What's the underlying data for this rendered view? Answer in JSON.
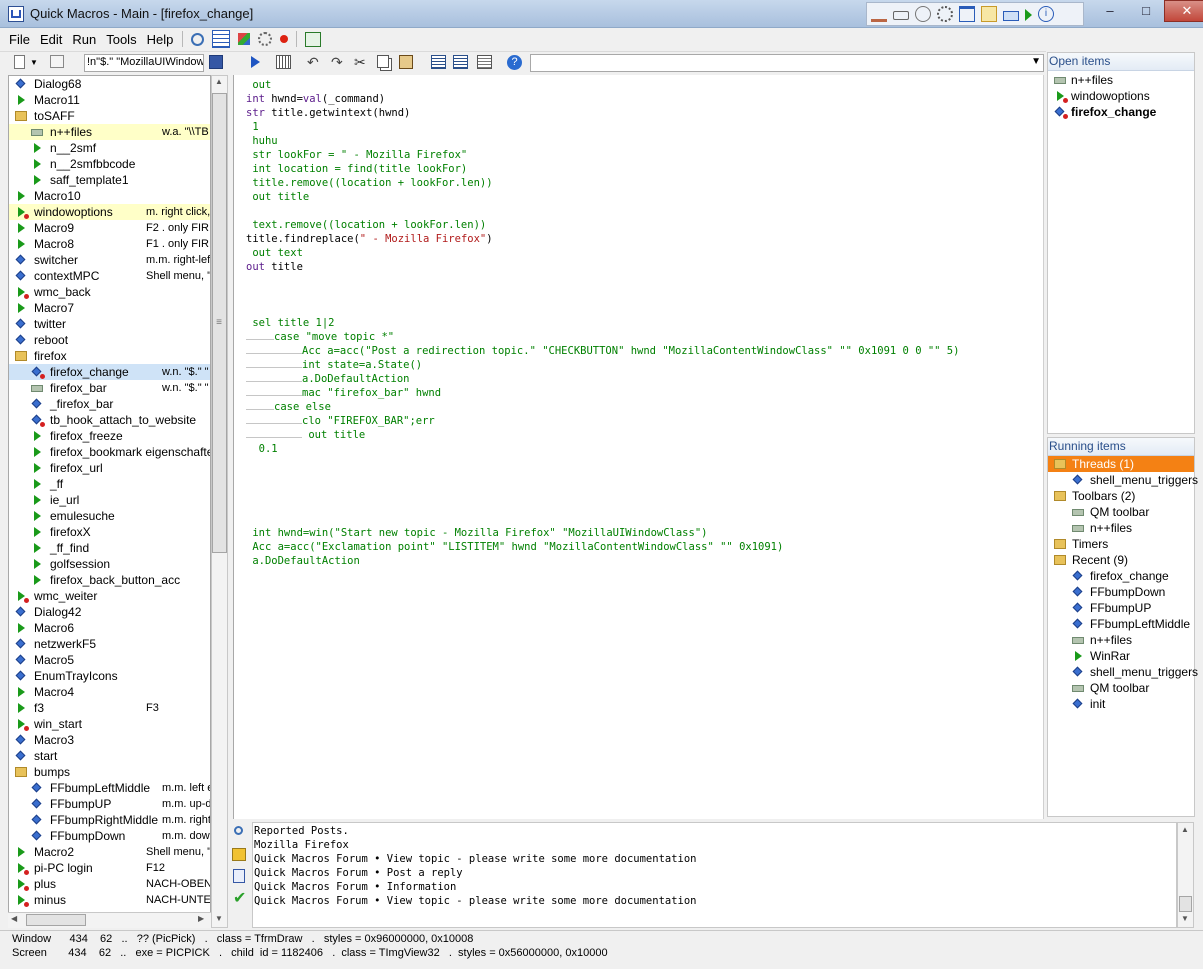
{
  "window": {
    "title": "Quick Macros - Main - [firefox_change]",
    "controls": {
      "minimize": "–",
      "maximize": "□",
      "close": "✕"
    }
  },
  "menu": {
    "items": [
      "File",
      "Edit",
      "Run",
      "Tools",
      "Help"
    ]
  },
  "toolbar": {
    "command_text": "!n\"$.\" \"MozillaUIWindowCla",
    "find_value": ""
  },
  "tree": {
    "items": [
      {
        "label": "Dialog68",
        "icon": "macro",
        "indent": 0
      },
      {
        "label": "Macro11",
        "icon": "function",
        "indent": 0
      },
      {
        "label": "toSAFF",
        "icon": "folder",
        "indent": 0
      },
      {
        "label": "n++files",
        "icon": "toolbar",
        "indent": 1,
        "trigger": "w.a. \"\\\\TB",
        "highlight": true
      },
      {
        "label": "n__2smf",
        "icon": "function",
        "indent": 1
      },
      {
        "label": "n__2smfbbcode",
        "icon": "function",
        "indent": 1
      },
      {
        "label": "saff_template1",
        "icon": "function",
        "indent": 1
      },
      {
        "label": "Macro10",
        "icon": "function",
        "indent": 0
      },
      {
        "label": "windowoptions",
        "icon": "function-red",
        "indent": 0,
        "trigger": "m. right click,",
        "highlight": true
      },
      {
        "label": "Macro9",
        "icon": "function",
        "indent": 0,
        "trigger": "F2  .  only FIR"
      },
      {
        "label": "Macro8",
        "icon": "function",
        "indent": 0,
        "trigger": "F1  .  only FIR"
      },
      {
        "label": "switcher",
        "icon": "macro",
        "indent": 0,
        "trigger": "m.m. right-left,"
      },
      {
        "label": "contextMPC",
        "icon": "macro",
        "indent": 0,
        "trigger": "Shell menu, \""
      },
      {
        "label": "wmc_back",
        "icon": "function-red",
        "indent": 0
      },
      {
        "label": "Macro7",
        "icon": "function",
        "indent": 0
      },
      {
        "label": "twitter",
        "icon": "macro",
        "indent": 0
      },
      {
        "label": "reboot",
        "icon": "macro",
        "indent": 0
      },
      {
        "label": "firefox",
        "icon": "folder",
        "indent": 0
      },
      {
        "label": "firefox_change",
        "icon": "macro-red",
        "indent": 1,
        "trigger": "w.n. \"$.\" \"",
        "selected": true
      },
      {
        "label": "firefox_bar",
        "icon": "toolbar",
        "indent": 1,
        "trigger": "w.n. \"$.\" \""
      },
      {
        "label": "_firefox_bar",
        "icon": "macro",
        "indent": 1
      },
      {
        "label": "tb_hook_attach_to_website",
        "icon": "macro-red",
        "indent": 1
      },
      {
        "label": "firefox_freeze",
        "icon": "function",
        "indent": 1
      },
      {
        "label": "firefox_bookmark eigenschaften",
        "icon": "function",
        "indent": 1
      },
      {
        "label": "firefox_url",
        "icon": "function",
        "indent": 1
      },
      {
        "label": "_ff",
        "icon": "function",
        "indent": 1
      },
      {
        "label": "ie_url",
        "icon": "function",
        "indent": 1
      },
      {
        "label": "emulesuche",
        "icon": "function",
        "indent": 1
      },
      {
        "label": "firefoxX",
        "icon": "function",
        "indent": 1
      },
      {
        "label": "_ff_find",
        "icon": "function",
        "indent": 1
      },
      {
        "label": "golfsession",
        "icon": "function",
        "indent": 1
      },
      {
        "label": "firefox_back_button_acc",
        "icon": "function",
        "indent": 1
      },
      {
        "label": "wmc_weiter",
        "icon": "function-red",
        "indent": 0
      },
      {
        "label": "Dialog42",
        "icon": "macro",
        "indent": 0
      },
      {
        "label": "Macro6",
        "icon": "function",
        "indent": 0
      },
      {
        "label": "netzwerkF5",
        "icon": "macro",
        "indent": 0
      },
      {
        "label": "Macro5",
        "icon": "macro",
        "indent": 0
      },
      {
        "label": "EnumTrayIcons",
        "icon": "macro",
        "indent": 0
      },
      {
        "label": "Macro4",
        "icon": "function",
        "indent": 0
      },
      {
        "label": "f3",
        "icon": "function",
        "indent": 0,
        "trigger": "F3"
      },
      {
        "label": "win_start",
        "icon": "function-red",
        "indent": 0
      },
      {
        "label": "Macro3",
        "icon": "macro",
        "indent": 0
      },
      {
        "label": "start",
        "icon": "macro",
        "indent": 0
      },
      {
        "label": "bumps",
        "icon": "folder",
        "indent": 0
      },
      {
        "label": "FFbumpLeftMiddle",
        "icon": "macro",
        "indent": 1,
        "trigger": "m.m. left e"
      },
      {
        "label": "FFbumpUP",
        "icon": "macro",
        "indent": 1,
        "trigger": "m.m. up-do"
      },
      {
        "label": "FFbumpRightMiddle",
        "icon": "macro",
        "indent": 1,
        "trigger": "m.m. right"
      },
      {
        "label": "FFbumpDown",
        "icon": "macro",
        "indent": 1,
        "trigger": "m.m. dowr"
      },
      {
        "label": "Macro2",
        "icon": "function",
        "indent": 0,
        "trigger": "Shell menu, \""
      },
      {
        "label": "pi-PC login",
        "icon": "function-red",
        "indent": 0,
        "trigger": "F12"
      },
      {
        "label": "plus",
        "icon": "function-red",
        "indent": 0,
        "trigger": "NACH-OBEN"
      },
      {
        "label": "minus",
        "icon": "function-red",
        "indent": 0,
        "trigger": "NACH-UNTE"
      }
    ]
  },
  "editor": {
    "lines": [
      {
        "row": 0,
        "type": "cmt",
        "text": " out"
      },
      {
        "row": 1,
        "type": "code",
        "parts": [
          [
            "kw",
            "int"
          ],
          [
            "plain",
            " hwnd="
          ],
          [
            "kw",
            "val"
          ],
          [
            "plain",
            "(_command)"
          ]
        ]
      },
      {
        "row": 2,
        "type": "code",
        "parts": [
          [
            "kw",
            "str"
          ],
          [
            "plain",
            " title.getwintext(hwnd)"
          ]
        ]
      },
      {
        "row": 3,
        "type": "cmt",
        "text": " 1"
      },
      {
        "row": 4,
        "type": "cmt",
        "text": " huhu"
      },
      {
        "row": 5,
        "type": "cmt",
        "text": " str lookFor = \" - Mozilla Firefox\""
      },
      {
        "row": 6,
        "type": "cmt",
        "text": " int location = find(title lookFor)"
      },
      {
        "row": 7,
        "type": "cmt",
        "text": " title.remove((location + lookFor.len))"
      },
      {
        "row": 8,
        "type": "cmt",
        "text": " out title"
      },
      {
        "row": 10,
        "type": "cmt",
        "text": " text.remove((location + lookFor.len))"
      },
      {
        "row": 11,
        "type": "code",
        "parts": [
          [
            "plain",
            "title.findreplace("
          ],
          [
            "str",
            "\" - Mozilla Firefox\""
          ],
          [
            "plain",
            ")"
          ]
        ]
      },
      {
        "row": 12,
        "type": "cmt",
        "text": " out text"
      },
      {
        "row": 13,
        "type": "code",
        "parts": [
          [
            "kw",
            "out"
          ],
          [
            "plain",
            " title"
          ]
        ]
      },
      {
        "row": 17,
        "type": "cmt",
        "text": " sel title 1|2"
      },
      {
        "row": 18,
        "type": "cmt",
        "indent": 1,
        "text": "case \"move topic *\""
      },
      {
        "row": 19,
        "type": "cmt",
        "indent": 2,
        "text": "Acc a=acc(\"Post a redirection topic.\" \"CHECKBUTTON\" hwnd \"MozillaContentWindowClass\" \"\" 0x1091 0 0 \"\" 5)"
      },
      {
        "row": 20,
        "type": "cmt",
        "indent": 2,
        "text": "int state=a.State()"
      },
      {
        "row": 21,
        "type": "cmt",
        "indent": 2,
        "text": "a.DoDefaultAction"
      },
      {
        "row": 22,
        "type": "cmt",
        "indent": 2,
        "text": "mac \"firefox_bar\" hwnd"
      },
      {
        "row": 23,
        "type": "cmt",
        "indent": 1,
        "text": "case else"
      },
      {
        "row": 24,
        "type": "cmt",
        "indent": 2,
        "text": "clo \"FIREFOX_BAR\";err"
      },
      {
        "row": 25,
        "type": "cmt",
        "indent": 2,
        "text": " out title"
      },
      {
        "row": 26,
        "type": "cmt",
        "text": "  0.1"
      },
      {
        "row": 32,
        "type": "cmt",
        "text": " int hwnd=win(\"Start new topic - Mozilla Firefox\" \"MozillaUIWindowClass\")"
      },
      {
        "row": 33,
        "type": "cmt",
        "text": " Acc a=acc(\"Exclamation point\" \"LISTITEM\" hwnd \"MozillaContentWindowClass\" \"\" 0x1091)"
      },
      {
        "row": 34,
        "type": "cmt",
        "text": " a.DoDefaultAction"
      }
    ]
  },
  "open_items": {
    "header": "Open items",
    "items": [
      {
        "label": "n++files",
        "icon": "toolbar"
      },
      {
        "label": "windowoptions",
        "icon": "function-red"
      },
      {
        "label": "firefox_change",
        "icon": "macro-red",
        "bold": true
      }
    ]
  },
  "running_items": {
    "header": "Running items",
    "items": [
      {
        "label": "Threads (1)",
        "icon": "folder",
        "indent": 0,
        "active": true
      },
      {
        "label": "shell_menu_triggers",
        "icon": "macro",
        "indent": 1
      },
      {
        "label": "Toolbars (2)",
        "icon": "folder",
        "indent": 0
      },
      {
        "label": "QM toolbar",
        "icon": "toolbar",
        "indent": 1
      },
      {
        "label": "n++files",
        "icon": "toolbar",
        "indent": 1
      },
      {
        "label": "Timers",
        "icon": "folder",
        "indent": 0
      },
      {
        "label": "Recent (9)",
        "icon": "folder",
        "indent": 0
      },
      {
        "label": "firefox_change",
        "icon": "macro",
        "indent": 1
      },
      {
        "label": "FFbumpDown",
        "icon": "macro",
        "indent": 1
      },
      {
        "label": "FFbumpUP",
        "icon": "macro",
        "indent": 1
      },
      {
        "label": "FFbumpLeftMiddle",
        "icon": "macro",
        "indent": 1
      },
      {
        "label": "n++files",
        "icon": "toolbar",
        "indent": 1
      },
      {
        "label": "WinRar",
        "icon": "function",
        "indent": 1
      },
      {
        "label": "shell_menu_triggers",
        "icon": "macro",
        "indent": 1
      },
      {
        "label": "QM toolbar",
        "icon": "toolbar",
        "indent": 1
      },
      {
        "label": "init",
        "icon": "macro",
        "indent": 1
      }
    ]
  },
  "output": {
    "lines": [
      "Reported Posts.",
      "Mozilla Firefox",
      "Quick Macros Forum • View topic - please write some more documentation",
      "Quick Macros Forum • Post a reply",
      "Quick Macros Forum • Information",
      "Quick Macros Forum • View topic - please write some more documentation"
    ]
  },
  "status": {
    "line1": "Window      434    62   ..   ?? (PicPick)   .   class = TfrmDraw   .   styles = 0x96000000, 0x10008",
    "line2": "Screen       434    62   ..   exe = PICPICK   .   child  id = 1182406   .  class = TImgView32   .  styles = 0x56000000, 0x10000"
  }
}
